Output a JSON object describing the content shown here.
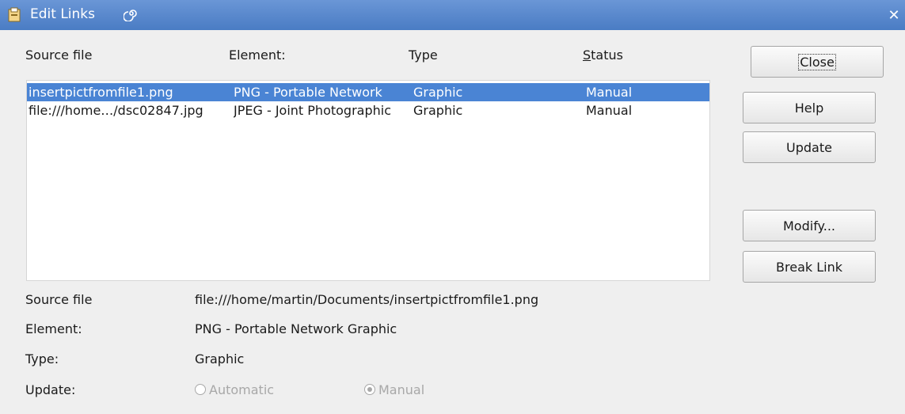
{
  "window": {
    "title": "Edit Links"
  },
  "list": {
    "columns": [
      "Source file",
      "Element:",
      "Type",
      "Status"
    ],
    "rows": [
      {
        "source": "insertpictfromfile1.png",
        "element": "PNG - Portable Network",
        "type": "Graphic",
        "status": "Manual",
        "selected": true
      },
      {
        "source": "file:///home…/dsc02847.jpg",
        "element": "JPEG - Joint Photographic",
        "type": "Graphic",
        "status": "Manual",
        "selected": false
      }
    ]
  },
  "buttons": {
    "close": "Close",
    "help": "Help",
    "update": "Update",
    "modify": "Modify...",
    "break_link": "Break Link"
  },
  "details": {
    "source_label": "Source file",
    "source_value": "file:///home/martin/Documents/insertpictfromfile1.png",
    "element_label": "Element:",
    "element_value": "PNG - Portable Network Graphic",
    "type_label": "Type:",
    "type_value": "Graphic",
    "update_label": "Update:",
    "automatic_label": "Automatic",
    "manual_label": "Manual",
    "update_mode": "manual"
  },
  "colors": {
    "selection": "#4a84d4",
    "titlebar": "#5584cc"
  }
}
